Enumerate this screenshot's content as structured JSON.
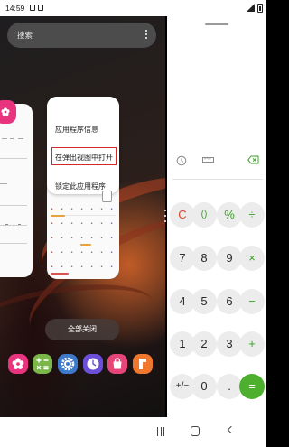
{
  "status_bar": {
    "time": "14:59"
  },
  "recents": {
    "search_placeholder": "搜索",
    "close_all_label": "全部关闭",
    "context_menu": {
      "items": [
        "应用程序信息",
        "在弹出视图中打开",
        "锁定此应用程序"
      ],
      "highlighted_index": 1
    },
    "dock_apps": [
      {
        "icon": "bixby-flower-icon",
        "color": "#e8347f"
      },
      {
        "icon": "calculator-icon",
        "color": "#7ab64a"
      },
      {
        "icon": "settings-gear-icon",
        "color": "#3f79c9"
      },
      {
        "icon": "clock-icon",
        "color": "#6c4fd8"
      },
      {
        "icon": "shopping-bag-icon",
        "color": "#e6457a"
      },
      {
        "icon": "flag-app-icon",
        "color": "#f0772e"
      }
    ]
  },
  "calculator": {
    "tools": [
      "history-clock-icon",
      "ruler-icon",
      "backspace-icon"
    ],
    "keypad": [
      [
        "C",
        "()",
        "%",
        "÷"
      ],
      [
        "7",
        "8",
        "9",
        "×"
      ],
      [
        "4",
        "5",
        "6",
        "−"
      ],
      [
        "1",
        "2",
        "3",
        "+"
      ],
      [
        "+/−",
        "0",
        ".",
        "="
      ]
    ],
    "colors": {
      "accent": "#4caf2e",
      "clear": "#e0452f",
      "key_bg": "#ececec"
    }
  },
  "navigation": {
    "buttons": [
      "recents-icon",
      "home-icon",
      "back-icon"
    ]
  }
}
